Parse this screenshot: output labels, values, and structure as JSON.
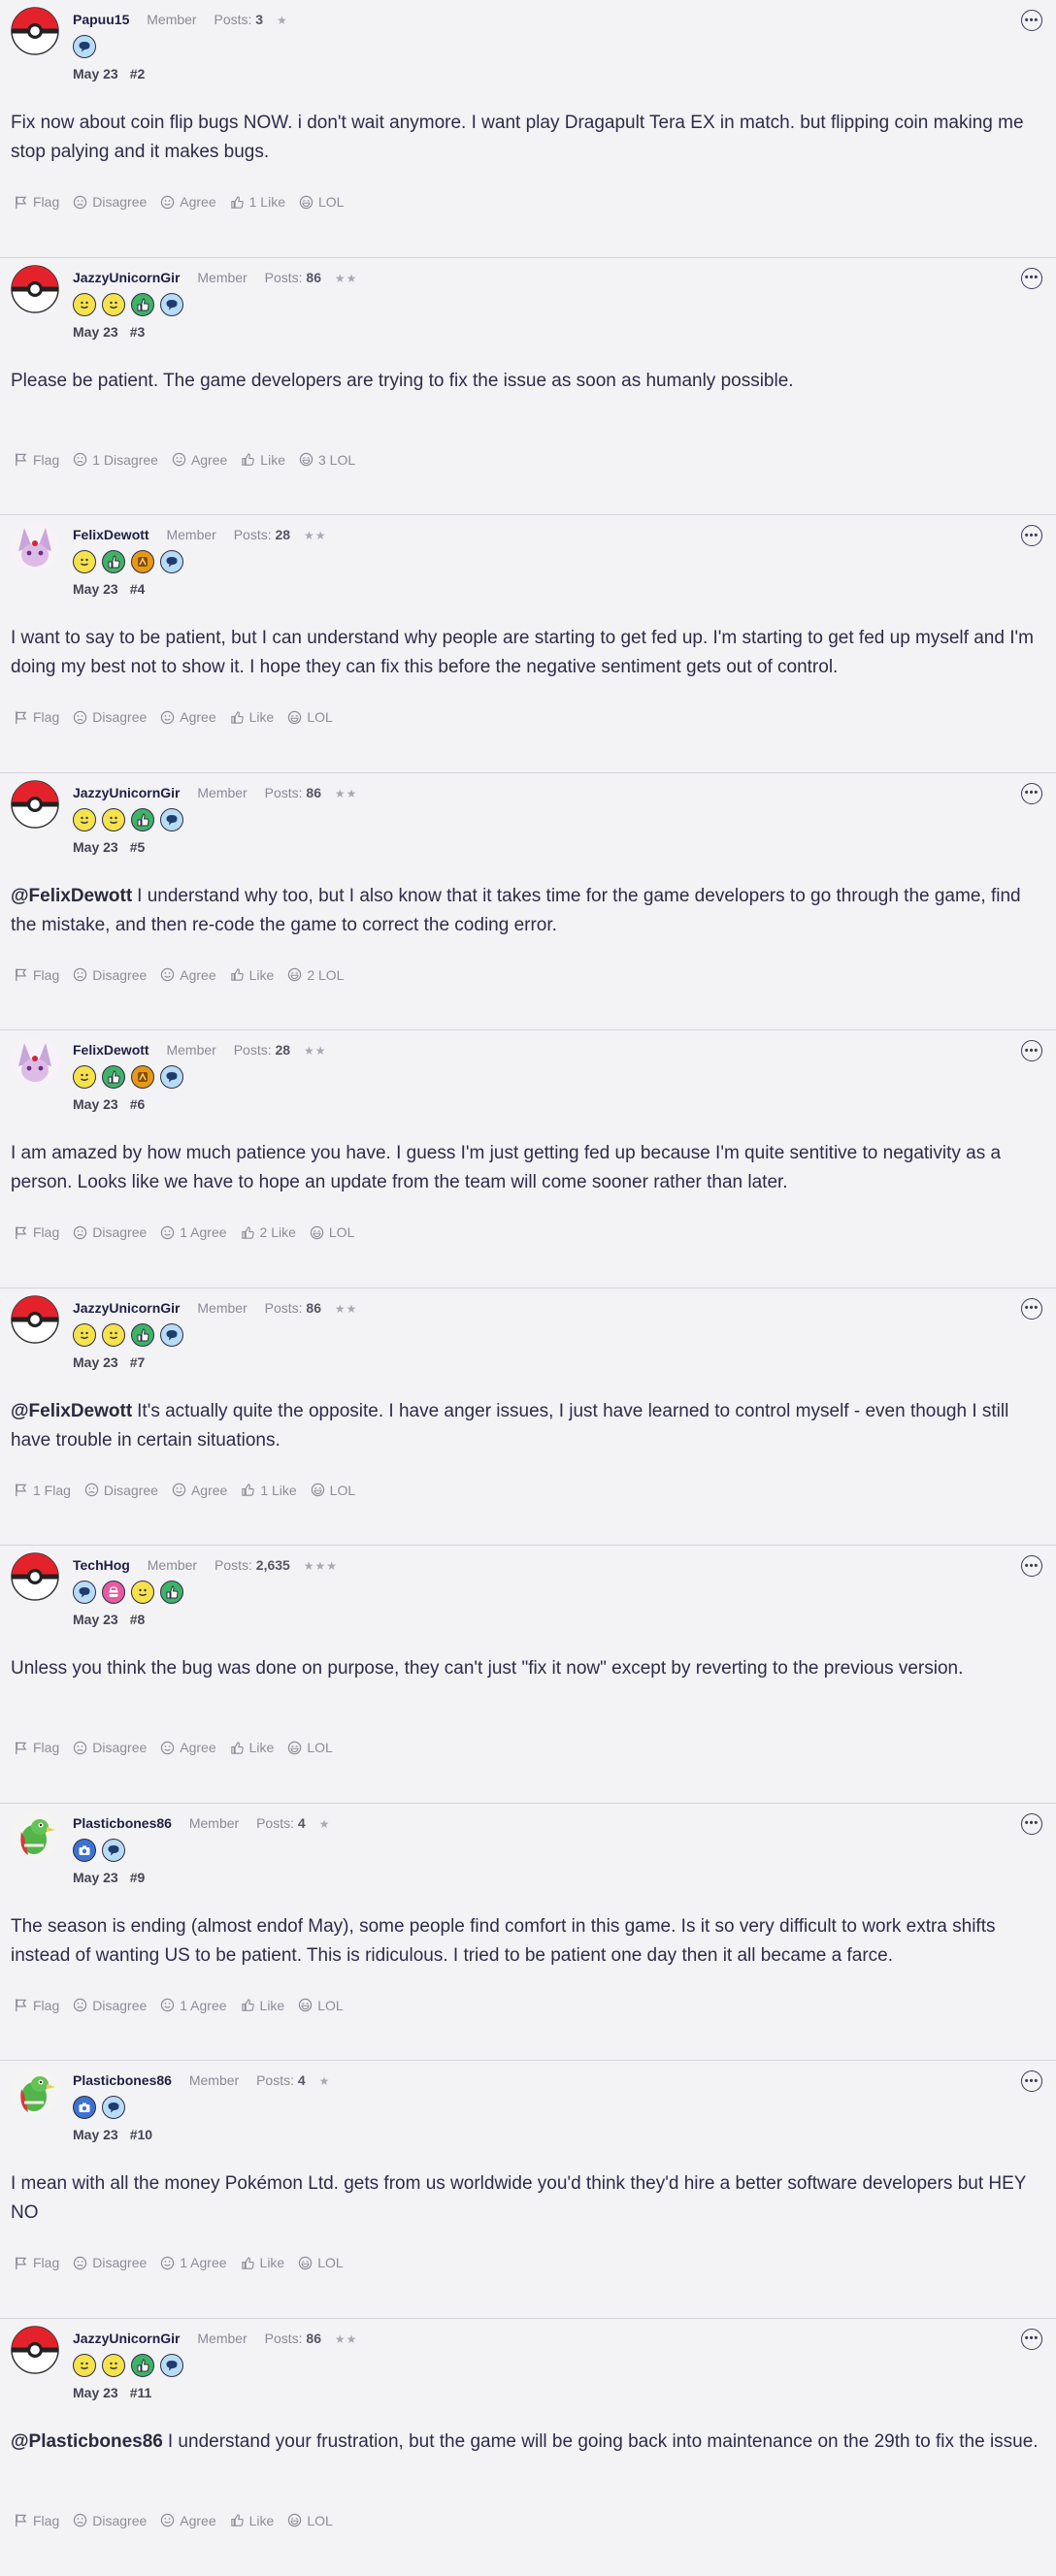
{
  "labels": {
    "role": "Member",
    "posts_prefix": "Posts:"
  },
  "posts": [
    {
      "username": "Papuu15",
      "role": "Member",
      "posts_count": "3",
      "stars": "★",
      "avatar": "pokeball",
      "badges": [
        "blue"
      ],
      "date": "May 23",
      "number": "#2",
      "mention": "",
      "text": "Fix now about coin flip bugs NOW. i don't wait anymore. I want play Dragapult Tera EX in match. but flipping coin making me stop palying and it makes bugs.",
      "actions": [
        "Flag",
        "Disagree",
        "Agree",
        "1 Like",
        "LOL"
      ]
    },
    {
      "username": "JazzyUnicornGir",
      "role": "Member",
      "posts_count": "86",
      "stars": "★★",
      "avatar": "pokeball",
      "badges": [
        "yellow",
        "yellow",
        "green",
        "blue"
      ],
      "date": "May 23",
      "number": "#3",
      "mention": "",
      "text": "Please be patient. The game developers are trying to fix the issue as soon as humanly possible.",
      "actions": [
        "Flag",
        "1 Disagree",
        "Agree",
        "Like",
        "3 LOL"
      ]
    },
    {
      "username": "FelixDewott",
      "role": "Member",
      "posts_count": "28",
      "stars": "★★",
      "avatar": "espeon",
      "badges": [
        "yellow",
        "green",
        "orange",
        "blue"
      ],
      "date": "May 23",
      "number": "#4",
      "mention": "",
      "text": "I want to say to be patient, but I can understand why people are starting to get fed up. I'm starting to get fed up myself and I'm doing my best not to show it. I hope they can fix this before the negative sentiment gets out of control.",
      "actions": [
        "Flag",
        "Disagree",
        "Agree",
        "Like",
        "LOL"
      ]
    },
    {
      "username": "JazzyUnicornGir",
      "role": "Member",
      "posts_count": "86",
      "stars": "★★",
      "avatar": "pokeball",
      "badges": [
        "yellow",
        "yellow",
        "green",
        "blue"
      ],
      "date": "May 23",
      "number": "#5",
      "mention": "@FelixDewott",
      "text": "I understand why too, but I also know that it takes time for the game developers to go through the game, find the mistake, and then re-code the game to correct the coding error.",
      "actions": [
        "Flag",
        "Disagree",
        "Agree",
        "Like",
        "2 LOL"
      ]
    },
    {
      "username": "FelixDewott",
      "role": "Member",
      "posts_count": "28",
      "stars": "★★",
      "avatar": "espeon",
      "badges": [
        "yellow",
        "green",
        "orange",
        "blue"
      ],
      "date": "May 23",
      "number": "#6",
      "mention": "",
      "text": "I am amazed by how much patience you have. I guess I'm just getting fed up because I'm quite sentitive to negativity as a person. Looks like we have to hope an update from the team will come sooner rather than later.",
      "actions": [
        "Flag",
        "Disagree",
        "1 Agree",
        "2 Like",
        "LOL"
      ]
    },
    {
      "username": "JazzyUnicornGir",
      "role": "Member",
      "posts_count": "86",
      "stars": "★★",
      "avatar": "pokeball",
      "badges": [
        "yellow",
        "yellow",
        "green",
        "blue"
      ],
      "date": "May 23",
      "number": "#7",
      "mention": "@FelixDewott",
      "text": "It's actually quite the opposite. I have anger issues, I just have learned to control myself - even though I still have trouble in certain situations.",
      "actions": [
        "1 Flag",
        "Disagree",
        "Agree",
        "1 Like",
        "LOL"
      ]
    },
    {
      "username": "TechHog",
      "role": "Member",
      "posts_count": "2,635",
      "stars": "★★★",
      "avatar": "pokeball",
      "badges": [
        "blue",
        "pink",
        "yellow",
        "green"
      ],
      "date": "May 23",
      "number": "#8",
      "mention": "",
      "text": "Unless you think the bug was done on purpose, they can't just \"fix it now\" except by reverting to the previous version.",
      "actions": [
        "Flag",
        "Disagree",
        "Agree",
        "Like",
        "LOL"
      ]
    },
    {
      "username": "Plasticbones86",
      "role": "Member",
      "posts_count": "4",
      "stars": "★",
      "avatar": "xatu",
      "badges": [
        "darkblue",
        "blue"
      ],
      "date": "May 23",
      "number": "#9",
      "mention": "",
      "text": "The season is ending (almost endof May), some people find comfort in this game. Is it so very difficult to work extra shifts instead of wanting US to be patient. This is ridiculous. I tried to be patient one day then it all became a farce.",
      "actions": [
        "Flag",
        "Disagree",
        "1 Agree",
        "Like",
        "LOL"
      ]
    },
    {
      "username": "Plasticbones86",
      "role": "Member",
      "posts_count": "4",
      "stars": "★",
      "avatar": "xatu",
      "badges": [
        "darkblue",
        "blue"
      ],
      "date": "May 23",
      "number": "#10",
      "mention": "",
      "text": "I mean with all the money Pokémon Ltd. gets from us worldwide you'd think they'd hire a better software developers but HEY NO",
      "actions": [
        "Flag",
        "Disagree",
        "1 Agree",
        "Like",
        "LOL"
      ]
    },
    {
      "username": "JazzyUnicornGir",
      "role": "Member",
      "posts_count": "86",
      "stars": "★★",
      "avatar": "pokeball",
      "badges": [
        "yellow",
        "yellow",
        "green",
        "blue"
      ],
      "date": "May 23",
      "number": "#11",
      "mention": "@Plasticbones86",
      "text": "I understand your frustration, but the game will be going back into maintenance on the 29th to fix the issue.",
      "actions": [
        "Flag",
        "Disagree",
        "Agree",
        "Like",
        "LOL"
      ]
    }
  ]
}
